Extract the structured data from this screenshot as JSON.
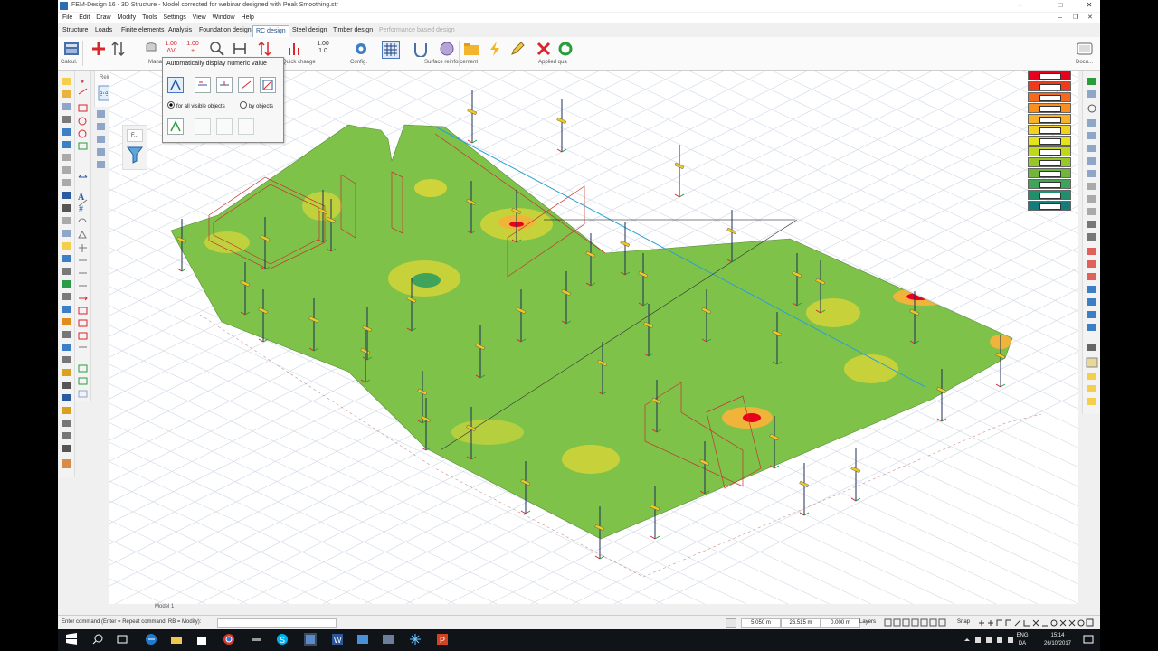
{
  "window": {
    "title": "FEM-Design 16 - 3D Structure - Model corrected for webinar designed with Peak Smoothing.str",
    "controls": [
      "–",
      "□",
      "✕"
    ]
  },
  "menu": [
    "File",
    "Edit",
    "Draw",
    "Modify",
    "Tools",
    "Settings",
    "View",
    "Window",
    "Help"
  ],
  "mdi_controls": [
    "–",
    "❐",
    "✕"
  ],
  "tabs": [
    "Structure",
    "Loads",
    "Finite elements",
    "Analysis",
    "Foundation design",
    "RC design",
    "Steel design",
    "Timber design",
    "Performance based design"
  ],
  "active_tab": "RC design",
  "ribbon": {
    "groups": [
      "Calcul.",
      "Mana",
      "Quick change",
      "Config.",
      "Surface reinforcement",
      "Applied qua",
      "Docu..."
    ],
    "numeric_icons": [
      {
        "top": "1.00",
        "bottom": "ΔV"
      },
      {
        "top": "1.00",
        "bottom": "+"
      },
      {
        "top": "1.00",
        "bottom": "1.0"
      }
    ]
  },
  "popup": {
    "title": "Automatically display numeric value",
    "radio_all": "for all visible objects",
    "radio_by": "by objects",
    "selected": "all"
  },
  "reinforcement_panel": {
    "label": "Reinforcement layer"
  },
  "filter_panel": {
    "label": "F..."
  },
  "legend": {
    "colors": [
      "#e8001c",
      "#f03a1c",
      "#f56a1e",
      "#f88f1f",
      "#f7b227",
      "#f0d21f",
      "#e3e51a",
      "#bfd81e",
      "#98c72a",
      "#6fb63a",
      "#3fa35a",
      "#1f8f6c",
      "#147c7a"
    ]
  },
  "viewport": {
    "tab_label": "Model 1"
  },
  "command": {
    "prompt": "Enter command (Enter = Repeat command; RB = Modify):"
  },
  "status": {
    "x": "5.050 m",
    "y": "26.515 m",
    "z": "0.000 m",
    "layers": "Layers",
    "snap": "Snap"
  },
  "taskbar": {
    "lang_top": "ENG",
    "lang_bottom": "DA",
    "time": "15:14",
    "date": "26/10/2017"
  }
}
